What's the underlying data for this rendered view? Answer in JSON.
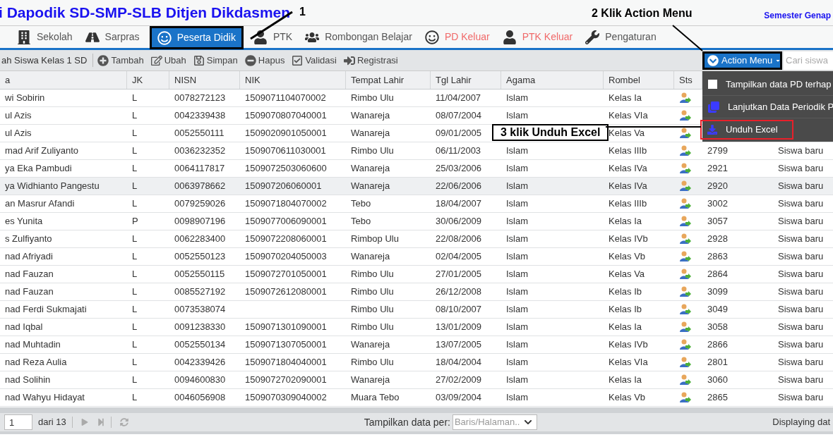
{
  "header": {
    "title": "i Dapodik SD-SMP-SLB Ditjen Dikdasmen",
    "semester": "Semester Genap"
  },
  "nav": [
    {
      "label": "Sekolah",
      "selected": false
    },
    {
      "label": "Sarpras",
      "selected": false
    },
    {
      "label": "Peserta Didik",
      "selected": true
    },
    {
      "label": "PTK",
      "selected": false
    },
    {
      "label": "Rombongan Belajar",
      "selected": false
    },
    {
      "label": "PD Keluar",
      "selected": false,
      "color": "#f06a6a"
    },
    {
      "label": "PTK Keluar",
      "selected": false,
      "color": "#f06a6a"
    },
    {
      "label": "Pengaturan",
      "selected": false
    }
  ],
  "toolbar": {
    "lead": "ah Siswa Kelas 1 SD",
    "buttons": [
      "Tambah",
      "Ubah",
      "Simpan",
      "Hapus",
      "Validasi",
      "Registrasi"
    ],
    "action_menu": "Action Menu",
    "search": {
      "placeholder": "Cari siswa"
    }
  },
  "action_menu_items": [
    {
      "kind": "checkbox",
      "label": "Tampilkan data PD terhap",
      "checked": false,
      "highlighted": false
    },
    {
      "kind": "copy",
      "label": "Lanjutkan Data Periodik P",
      "highlighted": false
    },
    {
      "kind": "download",
      "label": "Unduh Excel",
      "highlighted": true
    }
  ],
  "table": {
    "columns": [
      "a",
      "JK",
      "NISN",
      "NIK",
      "Tempat Lahir",
      "Tgl Lahir",
      "Agama",
      "Rombel",
      "Sts"
    ],
    "rows": [
      {
        "cells": [
          "wi Sobirin",
          "L",
          "0078272123",
          "1509071104070002",
          "Rimbo Ulu",
          "11/04/2007",
          "Islam",
          "Kelas Ia"
        ],
        "selected": false
      },
      {
        "cells": [
          "ul Azis",
          "L",
          "0042339438",
          "1509070807040001",
          "Wanareja",
          "08/07/2004",
          "Islam",
          "Kelas VIa"
        ],
        "selected": false
      },
      {
        "cells": [
          "ul Azis",
          "L",
          "0052550111",
          "1509020901050001",
          "Wanareja",
          "09/01/2005",
          null,
          "Kelas Va"
        ],
        "selected": false
      },
      {
        "cells": [
          "mad Arif Zuliyanto",
          "L",
          "0036232352",
          "1509070611030001",
          "Rimbo Ulu",
          "06/11/2003",
          "Islam",
          "Kelas IIIb"
        ],
        "no": "2799",
        "status": "Siswa baru",
        "selected": false
      },
      {
        "cells": [
          "ya Eka Pambudi",
          "L",
          "0064117817",
          "1509072503060600",
          "Wanareja",
          "25/03/2006",
          "Islam",
          "Kelas IVa"
        ],
        "no": "2921",
        "status": "Siswa baru",
        "selected": false
      },
      {
        "cells": [
          "ya Widhianto Pangestu",
          "L",
          "0063978662",
          "150907206060001",
          "Wanareja",
          "22/06/2006",
          "Islam",
          "Kelas IVa"
        ],
        "no": "2920",
        "status": "Siswa baru",
        "selected": true
      },
      {
        "cells": [
          "an Masrur Afandi",
          "L",
          "0079259026",
          "1509071804070002",
          "Tebo",
          "18/04/2007",
          "Islam",
          "Kelas IIIb"
        ],
        "no": "3002",
        "status": "Siswa baru",
        "selected": false
      },
      {
        "cells": [
          "es Yunita",
          "P",
          "0098907196",
          "1509077006090001",
          "Tebo",
          "30/06/2009",
          "Islam",
          "Kelas Ia"
        ],
        "no": "3057",
        "status": "Siswa baru",
        "selected": false
      },
      {
        "cells": [
          "s Zulfiyanto",
          "L",
          "0062283400",
          "1509072208060001",
          "Rimbop Ulu",
          "22/08/2006",
          "Islam",
          "Kelas IVb"
        ],
        "no": "2928",
        "status": "Siswa baru",
        "selected": false
      },
      {
        "cells": [
          "nad Afriyadi",
          "L",
          "0052550123",
          "1509070204050003",
          "Wanareja",
          "02/04/2005",
          "Islam",
          "Kelas Vb"
        ],
        "no": "2863",
        "status": "Siswa baru",
        "selected": false
      },
      {
        "cells": [
          "nad Fauzan",
          "L",
          "0052550115",
          "1509072701050001",
          "Rimbo Ulu",
          "27/01/2005",
          "Islam",
          "Kelas Va"
        ],
        "no": "2864",
        "status": "Siswa baru",
        "selected": false
      },
      {
        "cells": [
          "nad Fauzan",
          "L",
          "0085527192",
          "1509072612080001",
          "Rimbo Ulu",
          "26/12/2008",
          "Islam",
          "Kelas Ib"
        ],
        "no": "3099",
        "status": "Siswa baru",
        "selected": false
      },
      {
        "cells": [
          "nad Ferdi Sukmajati",
          "L",
          "0073538074",
          null,
          "Rimbo Ulu",
          "08/10/2007",
          "Islam",
          "Kelas Ib"
        ],
        "no": "3049",
        "status": "Siswa baru",
        "selected": false
      },
      {
        "cells": [
          "nad Iqbal",
          "L",
          "0091238330",
          "1509071301090001",
          "Rimbo Ulu",
          "13/01/2009",
          "Islam",
          "Kelas Ia"
        ],
        "no": "3058",
        "status": "Siswa baru",
        "selected": false
      },
      {
        "cells": [
          "nad Muhtadin",
          "L",
          "0052550134",
          "1509071307050001",
          "Wanareja",
          "13/07/2005",
          "Islam",
          "Kelas IVb"
        ],
        "no": "2866",
        "status": "Siswa baru",
        "selected": false
      },
      {
        "cells": [
          "nad Reza Aulia",
          "L",
          "0042339426",
          "1509071804040001",
          "Rimbo Ulu",
          "18/04/2004",
          "Islam",
          "Kelas VIa"
        ],
        "no": "2801",
        "status": "Siswa baru",
        "selected": false
      },
      {
        "cells": [
          "nad Solihin",
          "L",
          "0094600830",
          "1509072702090001",
          "Wanareja",
          "27/02/2009",
          "Islam",
          "Kelas Ia"
        ],
        "no": "3060",
        "status": "Siswa baru",
        "selected": false
      },
      {
        "cells": [
          "nad Wahyu Hidayat",
          "L",
          "0046056908",
          "1509070309040002",
          "Muara Tebo",
          "03/09/2004",
          "Islam",
          "Kelas Vb"
        ],
        "no": "2865",
        "status": "Siswa baru",
        "selected": false
      }
    ]
  },
  "pager": {
    "page": "1",
    "of": "dari 13",
    "per_page_label": "Tampilkan data per:",
    "per_page": {
      "placeholder": "Baris/Halaman.."
    },
    "display": "Displaying dat"
  },
  "annotations": [
    "1",
    "2 Klik Action Menu",
    "3 klik Unduh Excel"
  ]
}
